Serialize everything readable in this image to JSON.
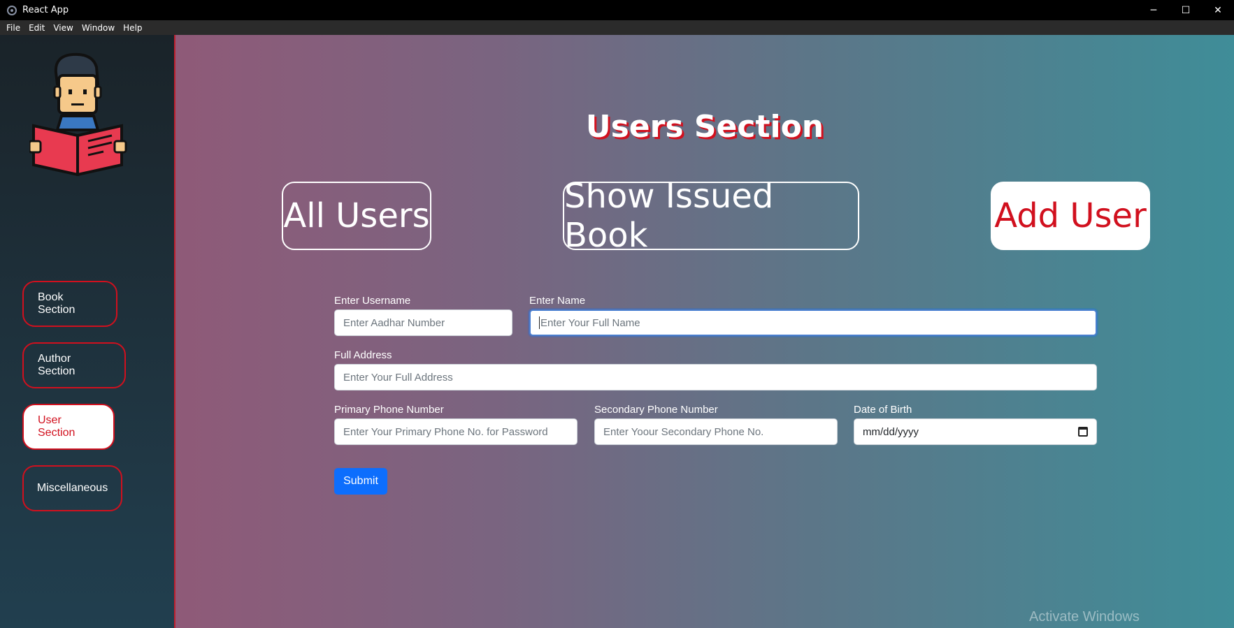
{
  "window": {
    "title": "React App",
    "controls": {
      "minimize": "─",
      "maximize": "☐",
      "close": "✕"
    }
  },
  "menubar": {
    "items": [
      "File",
      "Edit",
      "View",
      "Window",
      "Help"
    ]
  },
  "sidebar": {
    "logo_icon": "reading-person-icon",
    "items": [
      {
        "label": "Book Section",
        "active": false
      },
      {
        "label": "Author Section",
        "active": false
      },
      {
        "label": "User Section",
        "active": true
      },
      {
        "label": "Miscellaneous",
        "active": false
      }
    ]
  },
  "main": {
    "title": "Users Section",
    "tabs": [
      {
        "label": "All Users",
        "active": false
      },
      {
        "label": "Show Issued Book",
        "active": false
      },
      {
        "label": "Add User",
        "active": true
      }
    ],
    "form": {
      "username": {
        "label": "Enter Username",
        "placeholder": "Enter Aadhar Number"
      },
      "name": {
        "label": "Enter Name",
        "placeholder": "Enter Your Full Name"
      },
      "address": {
        "label": "Full Address",
        "placeholder": "Enter Your Full Address"
      },
      "primary_phone": {
        "label": "Primary Phone Number",
        "placeholder": "Enter Your Primary Phone No. for Password"
      },
      "secondary_phone": {
        "label": "Secondary Phone Number",
        "placeholder": "Enter Yoour Secondary Phone No."
      },
      "dob": {
        "label": "Date of Birth",
        "value": "mm/dd/yyyy"
      },
      "submit_label": "Submit"
    },
    "watermark": "Activate Windows"
  },
  "colors": {
    "accent_red": "#d1101e",
    "submit_blue": "#0d6efd",
    "focus_blue": "#4a7fd0"
  }
}
